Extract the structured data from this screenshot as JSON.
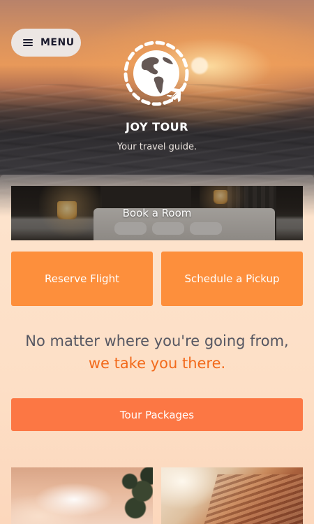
{
  "header": {
    "menu_label": "MENU",
    "brand": "JOY TOUR",
    "tagline": "Your travel guide."
  },
  "actions": {
    "book_room": "Book a Room",
    "reserve_flight": "Reserve Flight",
    "schedule_pickup": "Schedule a Pickup",
    "tour_packages": "Tour Packages"
  },
  "slogan": {
    "line1": "No matter where you're going from,",
    "line2": "we take you there."
  },
  "icons": {
    "menu": "hamburger-icon",
    "logo": "globe-airplane-logo"
  },
  "colors": {
    "accent_orange": "#fd8f3c",
    "tour_button": "#fc7744",
    "slogan_highlight": "#f26a1b",
    "slogan_text": "#565762",
    "menu_button_bg": "#ece6e3"
  }
}
